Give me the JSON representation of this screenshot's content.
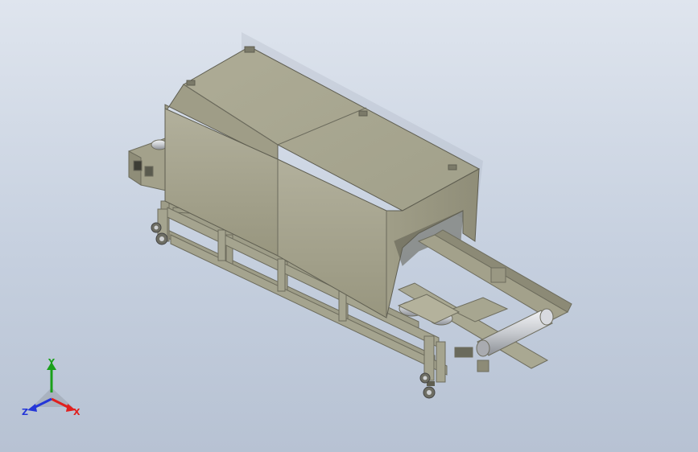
{
  "view": {
    "background_top": "#dfe5ee",
    "background_bottom": "#b7c2d3"
  },
  "model": {
    "body_color": "#a7a58f",
    "frame_color": "#9b9a86",
    "roller_color": "#c9ccd1"
  },
  "triad": {
    "x_label": "X",
    "y_label": "Y",
    "z_label": "Z",
    "x_color": "#e0201e",
    "y_color": "#1aa01a",
    "z_color": "#2436d8"
  }
}
